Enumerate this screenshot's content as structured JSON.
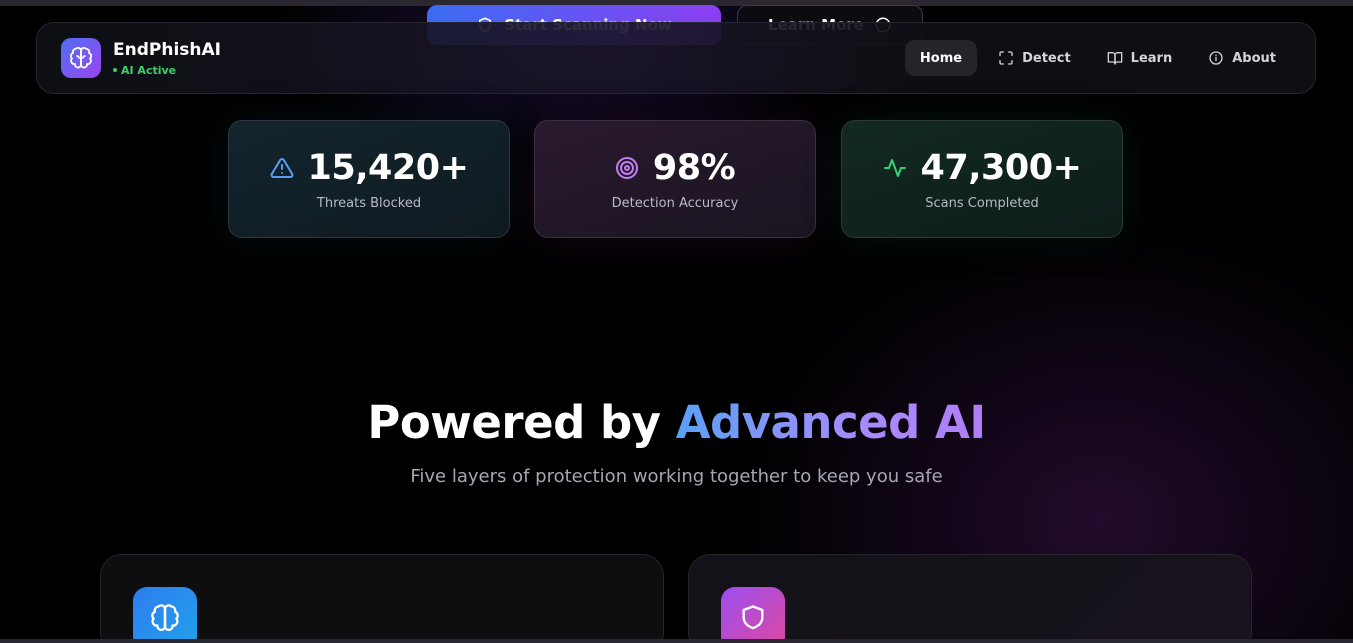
{
  "hero": {
    "primary_label": "Start Scanning Now",
    "secondary_label": "Learn More"
  },
  "brand": {
    "name": "EndPhishAI",
    "status": "AI Active",
    "logo_icon": "brain-icon"
  },
  "nav": {
    "items": [
      {
        "label": "Home",
        "icon": "",
        "active": true
      },
      {
        "label": "Detect",
        "icon": "scan-icon",
        "active": false
      },
      {
        "label": "Learn",
        "icon": "book-icon",
        "active": false
      },
      {
        "label": "About",
        "icon": "info-icon",
        "active": false
      }
    ]
  },
  "stats": [
    {
      "value": "15,420+",
      "label": "Threats Blocked",
      "icon": "alert-triangle-icon",
      "color": "#5b9df0"
    },
    {
      "value": "98%",
      "label": "Detection Accuracy",
      "icon": "target-icon",
      "color": "#c27ef5"
    },
    {
      "value": "47,300+",
      "label": "Scans Completed",
      "icon": "activity-icon",
      "color": "#35d07a"
    }
  ],
  "section": {
    "title_plain": "Powered by ",
    "title_accent": "Advanced AI",
    "subtitle": "Five layers of protection working together to keep you safe"
  },
  "features": [
    {
      "icon": "brain-icon"
    },
    {
      "icon": "shield-icon"
    }
  ],
  "colors": {
    "accent_blue": "#5aa0f5",
    "accent_purple": "#a78bfa",
    "status_green": "#3ecf6a"
  }
}
